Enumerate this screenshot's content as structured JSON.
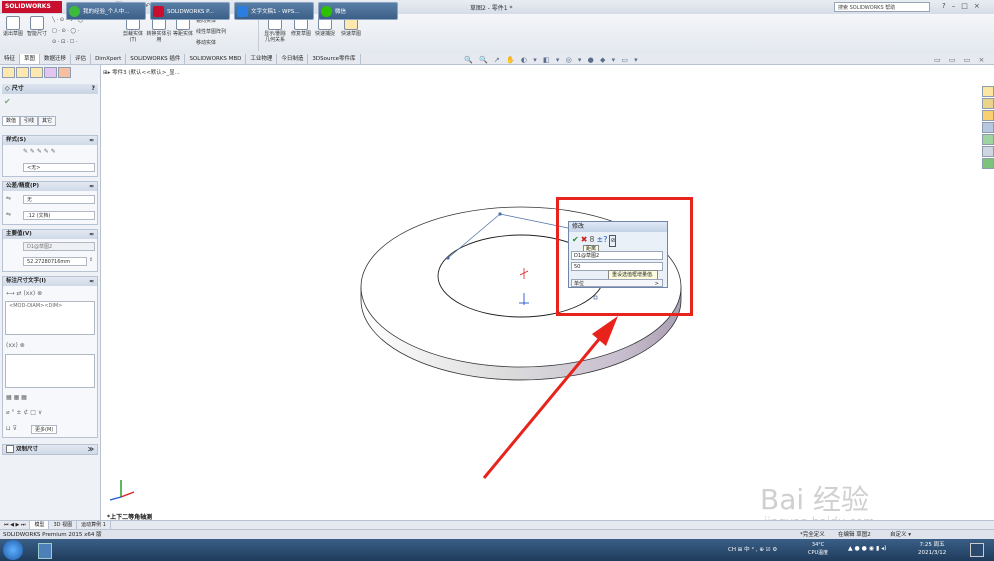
{
  "app": {
    "logo_text": "SOLIDWORKS",
    "document_title": "草图2 - 零件1 *",
    "help_search_placeholder": "搜索 SOLIDWORKS 帮助",
    "quick_access": [
      "□",
      "▾",
      "▭",
      "▾",
      "💾",
      "▾",
      "🖨",
      "▾",
      "↶",
      "▾",
      "↷",
      "▾",
      "▪",
      "▾"
    ],
    "window_buttons": [
      "?",
      "▾",
      "–",
      "□",
      "×"
    ]
  },
  "ribbon": {
    "buttons": [
      "退出草图",
      "智能尺寸",
      "剪裁实体(T)",
      "转换实体引用",
      "等距实体",
      "镜向实体",
      "线性草图阵列",
      "移动实体",
      "显示/删除几何关系",
      "修复草图",
      "快速捕捉",
      "快速草图"
    ],
    "small_tools": [
      "╲ · ⊙ · ∿ · ◯",
      "□ · ⊙ · ◯ ·",
      "⊙ · ⊡ · ☐ ·"
    ]
  },
  "tabs": [
    "特征",
    "草图",
    "数据迁移",
    "评估",
    "DimXpert",
    "SOLIDWORKS 插件",
    "SOLIDWORKS MBD",
    "工业物理",
    "今日制造",
    "3DSource零件库"
  ],
  "active_tab": "草图",
  "view_toolbar": "🔍 🔍 ↗ ✋ ◐ ▾ ◧ ▾ ◎ ▾ ● ◆ ▾ ▭ ▾",
  "viewport_controls": "▭ ▭ ▭ ×",
  "breadcrumb": "零件3 (默认<<默认>_显...",
  "property_manager": {
    "title": "尺寸",
    "help": "?",
    "ok": "✔",
    "sub_tabs": [
      "数值",
      "引线",
      "其它"
    ],
    "groups": {
      "style": {
        "title": "样式(S)",
        "icons": "✎ ✎ ✎ ✎ ✎",
        "value": "<无>"
      },
      "tolerance": {
        "title": "公差/精度(P)",
        "tolerance_type": "无",
        "precision": ".12 (文档)"
      },
      "primary_value": {
        "title": "主要值(V)",
        "name": "D1@草图2",
        "value": "52.27280716mm"
      },
      "dim_text": {
        "title": "标注尺寸文字(I)",
        "text": "<MOD-DIAM><DIM>",
        "icon_row_1": "⟷ ⇄ (xx) ⊗",
        "icon_row_2": "(xx) ⊗",
        "sym_row_1": "▦ ▦ ▦",
        "sym_row_2": "⌀ ° ± ⊄ □ ∨",
        "sym_row_3": "⊔ ⊽",
        "more_label": "更多(M)"
      },
      "dual": {
        "title": "双制尺寸"
      }
    }
  },
  "modify_dialog": {
    "title": "修改",
    "buttons": [
      "✔",
      "✖",
      "8",
      "±?",
      "⊘"
    ],
    "tooltip_distance": "距离",
    "dim_name": "D1@草图2",
    "dim_value": "50",
    "tooltip_rebuild": "重设选值框增量值.",
    "unit_label": "单位",
    "unit_arrow": ">"
  },
  "view_orientation_label": "*上下二等角轴测",
  "bottom_tabs": [
    "⏮ ◀ ▶ ⏭",
    "模型",
    "3D 视图",
    "运动算例 1"
  ],
  "active_bottom_tab": "模型",
  "status_bar": {
    "left": "SOLIDWORKS Premium 2015 x64 版",
    "mid1": "*完全定义",
    "mid2": "在编辑 草图2",
    "mid3": "自定义 ▾"
  },
  "taskbar": {
    "items": [
      "我的经验_个人中...",
      "SOLIDWORKS P...",
      "文字文稿1 - WPS...",
      "微信"
    ],
    "tray": "CH ⊞ 中 ° , ⊕ ☑ ⚙",
    "cpu_temp": "34°C",
    "cpu_label": "CPU温度",
    "time": "7:25 周五",
    "date": "2021/3/12"
  },
  "watermark": {
    "text": "Bai 经验",
    "sub": "jingyan.baidu.com"
  },
  "colors": {
    "highlight": "#e8231c",
    "accent": "#1f3b5c"
  }
}
